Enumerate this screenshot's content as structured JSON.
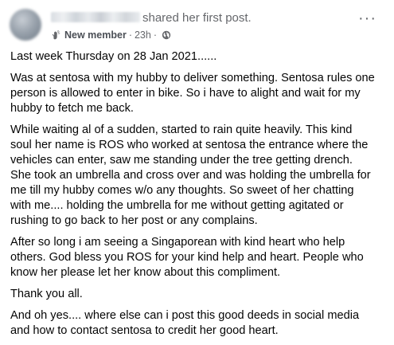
{
  "header": {
    "action_text": "shared her first post.",
    "badge_label": "New member",
    "separator": "·",
    "time": "23h",
    "badge_icon": "new-member-hand-icon",
    "privacy_icon": "globe-icon",
    "more_icon": "more-options-icon",
    "more_glyph": "···"
  },
  "post": {
    "paragraphs": [
      [
        "Last week Thursday on 28 Jan 2021......"
      ],
      [
        "Was at sentosa with my hubby to deliver something. Sentosa rules one",
        "person is allowed to enter in bike. So i have to alight and wait for my",
        "hubby to fetch me back."
      ],
      [
        "While waiting al of a sudden, started to rain quite heavily. This kind",
        "soul her name is ROS who worked at sentosa the entrance where the",
        "vehicles can enter, saw me standing under the tree getting drench.",
        "She took an umbrella and cross over and was holding the umbrella for",
        "me till my hubby comes w/o any thoughts. So sweet of her chatting",
        "with me.... holding the umbrella for me without getting agitated or",
        "rushing to go back to her post or any complains."
      ],
      [
        "After so long i am seeing a Singaporean with kind heart who help",
        "others. God bless you ROS for your kind help and heart. People who",
        "know her please let her know about this compliment."
      ],
      [
        "Thank you all."
      ],
      [
        "And oh yes.... where else can i post this good deeds in social media",
        "and how to contact sentosa to credit her good heart."
      ]
    ]
  }
}
